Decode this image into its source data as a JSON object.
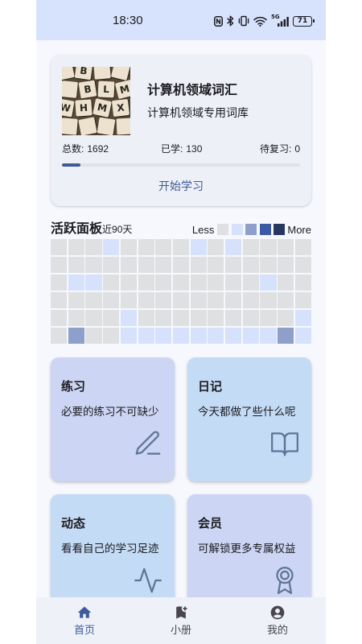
{
  "status_bar": {
    "time": "18:30",
    "network": "5G",
    "battery": "71",
    "icons": [
      "nfc-icon",
      "bluetooth-icon",
      "vibrate-icon",
      "wifi-icon",
      "signal-icon",
      "battery-icon"
    ]
  },
  "colors": {
    "primary": "#3f5a9a",
    "status_bar_bg": "#d7e2fd",
    "page_bg": "#f7f8fd",
    "card_bg": "#eef0f7",
    "nav_bg": "#eef1f8",
    "progress_fill": "#3d5a99",
    "progress_track": "#dfe2ea",
    "feature_icon": "#5f7393",
    "nav_inactive": "#49454f"
  },
  "wordbook": {
    "title": "计算机领域词汇",
    "subtitle": "计算机领域专用词库",
    "cover_tiles": [
      [
        "",
        "B",
        "",
        ""
      ],
      [
        "",
        "B",
        "L",
        "M"
      ],
      [
        "W",
        "H",
        "M",
        "X"
      ],
      [
        "",
        "",
        "",
        ""
      ]
    ],
    "stats": {
      "total_label": "总数:",
      "total": 1692,
      "learned_label": "已学:",
      "learned": 130,
      "review_label": "待复习:",
      "review": 0
    },
    "start_label": "开始学习"
  },
  "activity": {
    "title": "活跃面板",
    "range": "近90天",
    "legend_less": "Less",
    "legend_more": "More",
    "level_colors": [
      "#dfe0e2",
      "#d6e2fc",
      "#8e9fca",
      "#3d5aa5",
      "#26385f"
    ],
    "grid": [
      [
        0,
        0,
        0,
        1,
        0,
        0,
        0,
        0,
        1,
        0,
        1,
        0,
        0,
        0,
        0
      ],
      [
        0,
        0,
        0,
        0,
        0,
        0,
        0,
        0,
        0,
        0,
        0,
        0,
        0,
        0,
        0
      ],
      [
        0,
        1,
        1,
        0,
        0,
        0,
        0,
        0,
        0,
        0,
        0,
        0,
        1,
        0,
        0
      ],
      [
        0,
        0,
        0,
        0,
        0,
        0,
        0,
        0,
        0,
        0,
        0,
        0,
        0,
        0,
        0
      ],
      [
        0,
        0,
        0,
        0,
        1,
        0,
        0,
        0,
        0,
        0,
        0,
        0,
        0,
        0,
        1
      ],
      [
        0,
        2,
        0,
        0,
        1,
        1,
        1,
        1,
        1,
        1,
        1,
        1,
        1,
        2,
        1
      ]
    ]
  },
  "features": [
    {
      "title": "练习",
      "subtitle": "必要的练习不可缺少",
      "icon": "pencil-icon",
      "color": "#ccd6f4"
    },
    {
      "title": "日记",
      "subtitle": "今天都做了些什么呢",
      "icon": "book-open-icon",
      "color": "#c4dbf6"
    },
    {
      "title": "动态",
      "subtitle": "看看自己的学习足迹",
      "icon": "activity-icon",
      "color": "#c4dbf6"
    },
    {
      "title": "会员",
      "subtitle": "可解锁更多专属权益",
      "icon": "award-icon",
      "color": "#ccd6f4"
    }
  ],
  "bottom_nav": [
    {
      "label": "首页",
      "icon": "home-icon",
      "active": true
    },
    {
      "label": "小册",
      "icon": "bookmark-add-icon",
      "active": false
    },
    {
      "label": "我的",
      "icon": "account-circle-icon",
      "active": false
    }
  ]
}
